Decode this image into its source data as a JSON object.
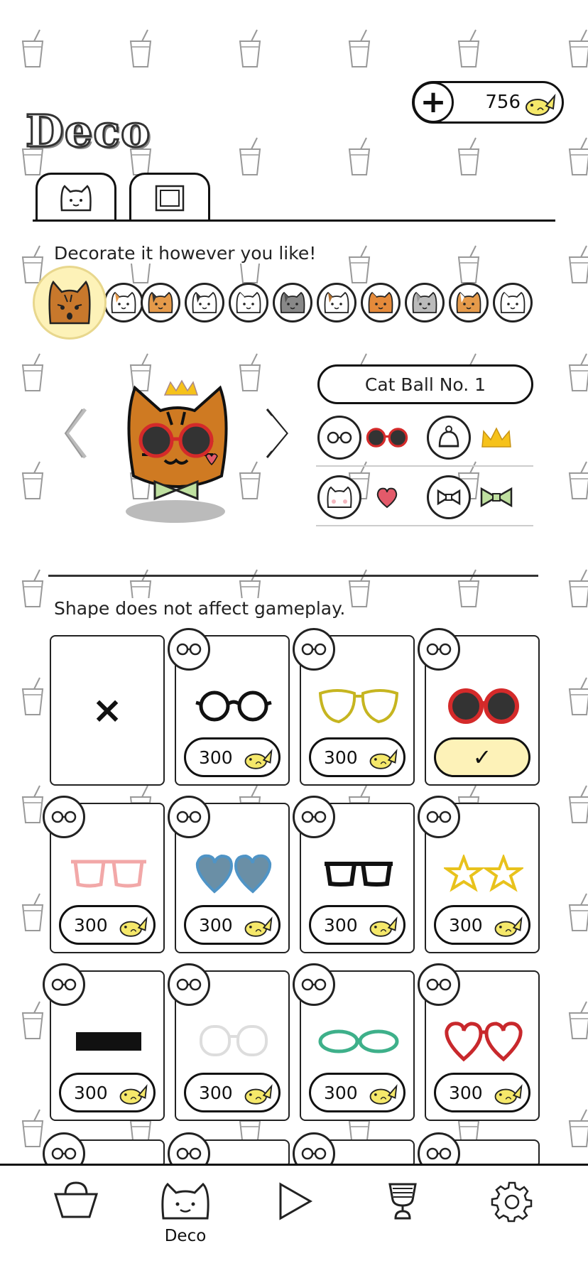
{
  "header": {
    "title": "Deco",
    "coins": "756",
    "add_coins_icon": "plus-icon",
    "currency_icon": "fish-coin-icon"
  },
  "tabs": [
    {
      "name": "cats-tab",
      "icon": "cat-face-icon",
      "active": true
    },
    {
      "name": "frames-tab",
      "icon": "frame-icon",
      "active": false
    }
  ],
  "decorate": {
    "hint": "Decorate it however you like!"
  },
  "preview": {
    "cat_name": "Cat Ball No. 1",
    "prev_icon": "chevron-left-icon",
    "next_icon": "chevron-right-icon"
  },
  "equip": {
    "rows": [
      [
        {
          "slot": "glasses-slot-icon",
          "item": "red-glasses-icon"
        },
        {
          "slot": "hat-slot-icon",
          "item": "crown-icon"
        }
      ],
      [
        {
          "slot": "face-slot-icon",
          "item": "heart-icon"
        },
        {
          "slot": "bowtie-slot-icon",
          "item": "green-bowtie-icon"
        }
      ]
    ]
  },
  "shop": {
    "hint": "Shape does not affect gameplay.",
    "none_mark": "×",
    "items": [
      {
        "name": "none",
        "price": "",
        "state": "none"
      },
      {
        "name": "round-black-glasses",
        "price": "300"
      },
      {
        "name": "yellow-outline-glasses",
        "price": "300"
      },
      {
        "name": "red-sunglasses",
        "price": "",
        "state": "equipped",
        "check": "✓"
      },
      {
        "name": "pink-glasses",
        "price": "300"
      },
      {
        "name": "blue-heart-glasses",
        "price": "300"
      },
      {
        "name": "black-rect-glasses",
        "price": "300"
      },
      {
        "name": "star-glasses",
        "price": "300"
      },
      {
        "name": "black-bar",
        "price": "300"
      },
      {
        "name": "white-glasses",
        "price": "300"
      },
      {
        "name": "green-oval-glasses",
        "price": "300"
      },
      {
        "name": "red-heart-glasses",
        "price": "300"
      }
    ]
  },
  "bottom_nav": [
    {
      "name": "shop",
      "icon": "shopping-basket-icon",
      "label": ""
    },
    {
      "name": "deco",
      "icon": "cat-face-icon",
      "label": "Deco"
    },
    {
      "name": "play",
      "icon": "play-icon",
      "label": ""
    },
    {
      "name": "trophy",
      "icon": "trophy-icon",
      "label": ""
    },
    {
      "name": "settings",
      "icon": "gear-icon",
      "label": ""
    }
  ],
  "colors": {
    "selected_bg": "#fdf2b8",
    "fish_yellow": "#f5e86a"
  }
}
